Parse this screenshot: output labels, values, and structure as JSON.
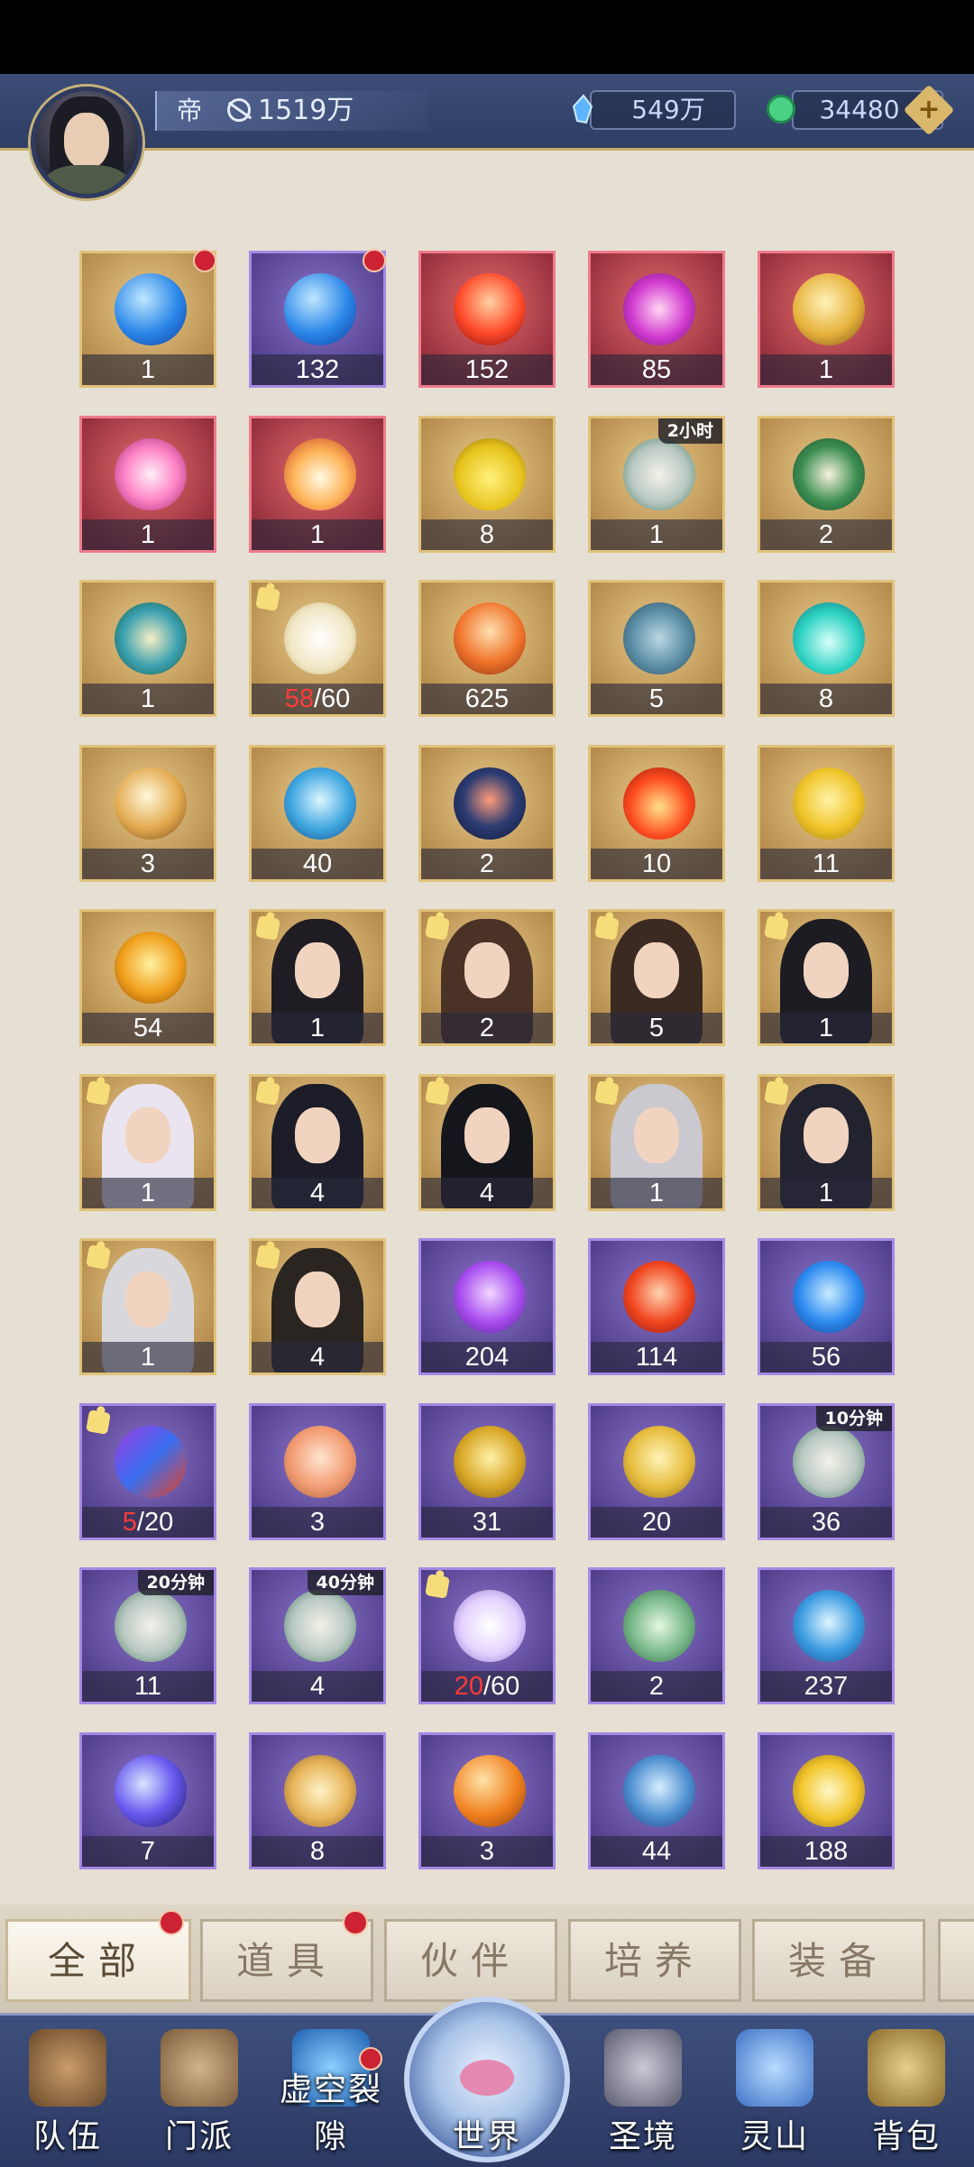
{
  "header": {
    "rank": "帝",
    "power": "1519万",
    "currency1": "549万",
    "currency2": "34480",
    "add_label": "+"
  },
  "items": [
    {
      "count": "1",
      "quality": "gold",
      "art": "blue-orb",
      "badge": true
    },
    {
      "count": "132",
      "quality": "purple",
      "art": "blue-orb",
      "badge": true
    },
    {
      "count": "152",
      "quality": "red",
      "art": "red-crystal"
    },
    {
      "count": "85",
      "quality": "red",
      "art": "pink-orb"
    },
    {
      "count": "1",
      "quality": "red",
      "art": "gold-orb"
    },
    {
      "count": "1",
      "quality": "red",
      "art": "pink-flame"
    },
    {
      "count": "1",
      "quality": "red",
      "art": "fire-flame"
    },
    {
      "count": "8",
      "quality": "gold",
      "art": "yellow-sand"
    },
    {
      "count": "1",
      "quality": "gold",
      "art": "scroll-quill",
      "timer": "2小时"
    },
    {
      "count": "2",
      "quality": "gold",
      "art": "book"
    },
    {
      "count": "1",
      "quality": "gold",
      "art": "map"
    },
    {
      "count_red": "58",
      "count_rest": "/60",
      "quality": "gold",
      "art": "white-feather",
      "shard": true
    },
    {
      "count": "625",
      "quality": "gold",
      "art": "orange-crystal"
    },
    {
      "count": "5",
      "quality": "gold",
      "art": "stone-tablet"
    },
    {
      "count": "8",
      "quality": "gold",
      "art": "teal-flame"
    },
    {
      "count": "3",
      "quality": "gold",
      "art": "pearl"
    },
    {
      "count": "40",
      "quality": "gold",
      "art": "blue-gem"
    },
    {
      "count": "2",
      "quality": "gold",
      "art": "dark-gem"
    },
    {
      "count": "10",
      "quality": "gold",
      "art": "flame-drop"
    },
    {
      "count": "11",
      "quality": "gold",
      "art": "ginkgo-leaf"
    },
    {
      "count": "54",
      "quality": "gold",
      "art": "amber-egg"
    },
    {
      "count": "1",
      "quality": "gold",
      "art": "hero",
      "shard": true,
      "hair": "#1f1c24"
    },
    {
      "count": "2",
      "quality": "gold",
      "art": "hero",
      "shard": true,
      "hair": "#4a3326"
    },
    {
      "count": "5",
      "quality": "gold",
      "art": "hero",
      "shard": true,
      "hair": "#3b2a22"
    },
    {
      "count": "1",
      "quality": "gold",
      "art": "hero",
      "shard": true,
      "hair": "#1c1c22"
    },
    {
      "count": "1",
      "quality": "gold",
      "art": "hero",
      "shard": true,
      "hair": "#e9e4ef"
    },
    {
      "count": "4",
      "quality": "gold",
      "art": "hero",
      "shard": true,
      "hair": "#1c1d28"
    },
    {
      "count": "4",
      "quality": "gold",
      "art": "hero",
      "shard": true,
      "hair": "#15151c"
    },
    {
      "count": "1",
      "quality": "gold",
      "art": "hero",
      "shard": true,
      "hair": "#c9c9cf"
    },
    {
      "count": "1",
      "quality": "gold",
      "art": "hero",
      "shard": true,
      "hair": "#22232e"
    },
    {
      "count": "1",
      "quality": "gold",
      "art": "hero",
      "shard": true,
      "hair": "#d8d8dc"
    },
    {
      "count": "4",
      "quality": "gold",
      "art": "hero",
      "shard": true,
      "hair": "#2a2520"
    },
    {
      "count": "204",
      "quality": "purple",
      "art": "purple-magatama"
    },
    {
      "count": "114",
      "quality": "purple",
      "art": "red-magatama"
    },
    {
      "count": "56",
      "quality": "purple",
      "art": "blue-magatama"
    },
    {
      "count_red": "5",
      "count_rest": "/20",
      "quality": "purple",
      "art": "mixed-magatama",
      "shard": true
    },
    {
      "count": "3",
      "quality": "purple",
      "art": "lotus-token"
    },
    {
      "count": "31",
      "quality": "purple",
      "art": "gold-talisman"
    },
    {
      "count": "20",
      "quality": "purple",
      "art": "gold-scroll"
    },
    {
      "count": "36",
      "quality": "purple",
      "art": "scroll-quill",
      "timer": "10分钟"
    },
    {
      "count": "11",
      "quality": "purple",
      "art": "scroll-quill",
      "timer": "20分钟"
    },
    {
      "count": "4",
      "quality": "purple",
      "art": "scroll-quill",
      "timer": "40分钟"
    },
    {
      "count_red": "20",
      "count_rest": "/60",
      "quality": "purple",
      "art": "purple-feather",
      "shard": true
    },
    {
      "count": "2",
      "quality": "purple",
      "art": "jade-tablet"
    },
    {
      "count": "237",
      "quality": "purple",
      "art": "blue-crystal"
    },
    {
      "count": "7",
      "quality": "purple",
      "art": "galaxy-orb"
    },
    {
      "count": "8",
      "quality": "purple",
      "art": "gold-sprout"
    },
    {
      "count": "3",
      "quality": "purple",
      "art": "orange-orb"
    },
    {
      "count": "44",
      "quality": "purple",
      "art": "blue-egg"
    },
    {
      "count": "188",
      "quality": "purple",
      "art": "gold-swirl"
    }
  ],
  "tabs": [
    {
      "label": "全部",
      "active": true,
      "badge": true
    },
    {
      "label": "道具",
      "badge": true
    },
    {
      "label": "伙伴"
    },
    {
      "label": "培养"
    },
    {
      "label": "装备"
    }
  ],
  "nav": [
    {
      "label": "队伍"
    },
    {
      "label": "门派"
    },
    {
      "label": "虚空裂隙",
      "badge": true
    },
    {
      "label": "世界"
    },
    {
      "label": "圣境"
    },
    {
      "label": "灵山"
    },
    {
      "label": "背包"
    }
  ],
  "colors": {
    "gold_frame": "#e0c27a",
    "red_frame": "#ee7b8c",
    "purple_frame": "#a58ae5",
    "badge": "#cc2233",
    "count_highlight": "#ff3b3b"
  }
}
